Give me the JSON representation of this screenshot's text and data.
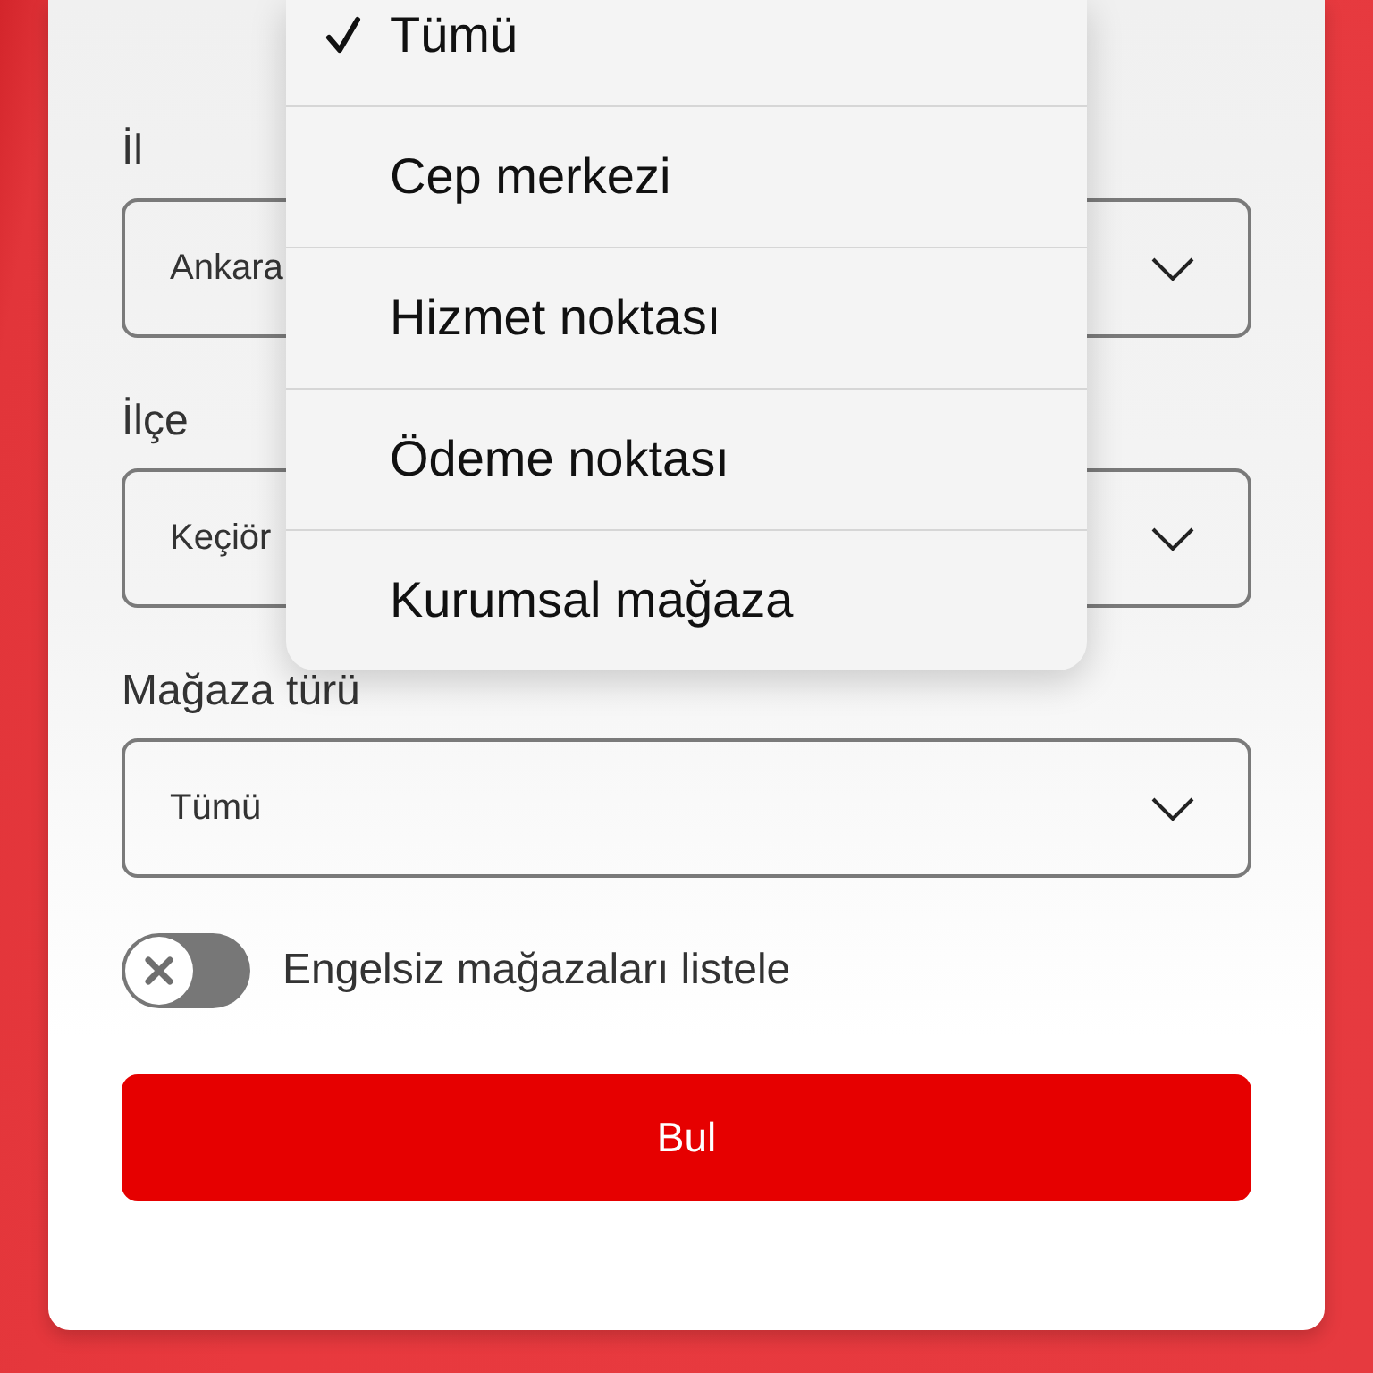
{
  "filters": [
    {
      "label": "İl",
      "value": "Ankara"
    },
    {
      "label": "İlçe",
      "value": "Keçiör"
    },
    {
      "label": "Mağaza türü",
      "value": "Tümü"
    }
  ],
  "toggle": {
    "label": "Engelsiz mağazaları listele",
    "on": false
  },
  "button": {
    "label": "Bul"
  },
  "dropdown": {
    "items": [
      {
        "label": "Tümü",
        "selected": true
      },
      {
        "label": "Cep merkezi",
        "selected": false
      },
      {
        "label": "Hizmet noktası",
        "selected": false
      },
      {
        "label": "Ödeme noktası",
        "selected": false
      },
      {
        "label": "Kurumsal mağaza",
        "selected": false
      }
    ]
  }
}
